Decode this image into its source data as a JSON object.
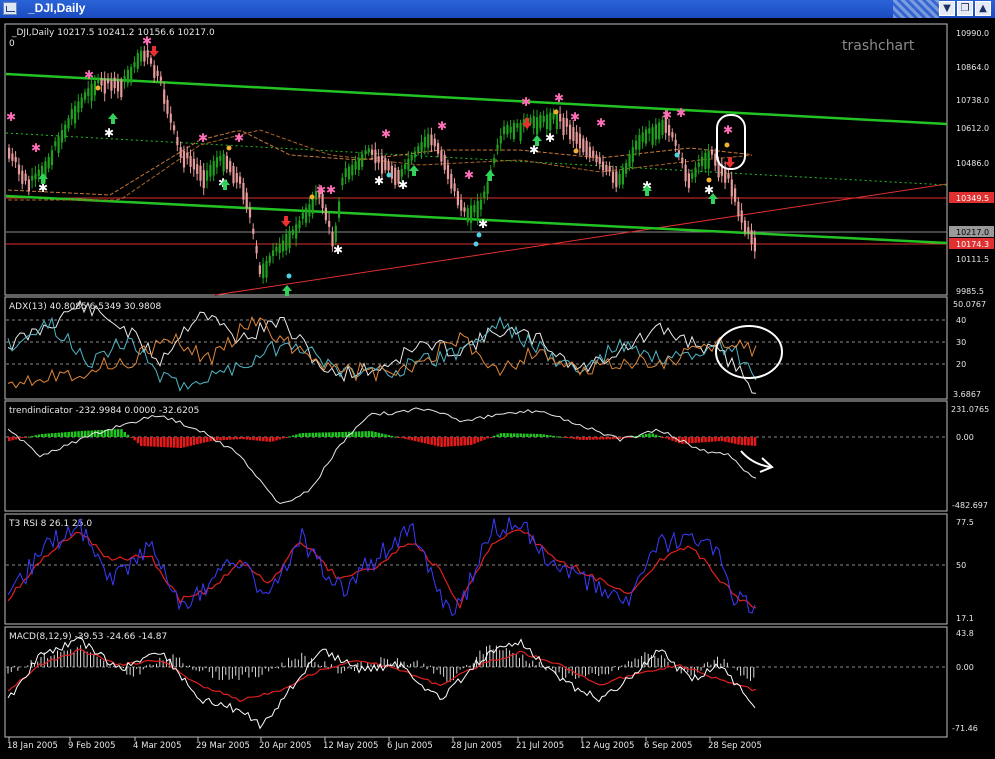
{
  "window": {
    "title": "_DJI,Daily",
    "controls": {
      "minimize": "▼",
      "restore": "❐",
      "close": "▲"
    }
  },
  "colors": {
    "background": "#000000",
    "panel_border": "#c0c0c0",
    "channel_line": "#22c322",
    "support_line": "#e03030",
    "candle_up": "#1fa11f",
    "candle_down": "#e69a9a",
    "adx_plus": "#4fb7c8",
    "adx_minus": "#e0873a",
    "trend_pos": "#1ec81e",
    "trend_neg": "#e61a1a",
    "rsi_fast": "#3b3bff",
    "rsi_slow": "#e02020",
    "macd_main": "#ffffff",
    "macd_signal": "#e02020"
  },
  "main_panel": {
    "header": "_DJI,Daily  10217.5  10241.2  10156.6  10217.0",
    "zero_label": "0",
    "watermark": "trashchart",
    "price_labels": [
      "10990.0",
      "10864.0",
      "10738.0",
      "10612.0",
      "10486.0",
      "10111.5",
      "9985.5"
    ],
    "highlight_labels": [
      {
        "text": "10349.5",
        "color": "#e03030"
      },
      {
        "text": "10217.0",
        "color": "#9a9a9a"
      },
      {
        "text": "10174.3",
        "color": "#e03030"
      }
    ]
  },
  "adx_panel": {
    "header": "ADX(13)  40.8085  6.5349  30.9808",
    "labels": [
      "50.0767",
      "40",
      "30",
      "20",
      "3.6867"
    ]
  },
  "trend_panel": {
    "header": "trendindicator  -232.9984  0.0000  -32.6205",
    "labels": [
      "231.0765",
      "0.00",
      "-482.697"
    ]
  },
  "rsi_panel": {
    "header": "T3 RSI  8  26.1  25.0",
    "labels": [
      "77.5",
      "50",
      "17.1"
    ]
  },
  "macd_panel": {
    "header": "MACD(8,12,9)  -39.53  -24.66  -14.87",
    "labels": [
      "43.8",
      "0.00",
      "-71.46"
    ]
  },
  "x_axis": {
    "labels": [
      "18 Jan 2005",
      "9 Feb 2005",
      "4 Mar 2005",
      "29 Mar 2005",
      "20 Apr 2005",
      "12 May 2005",
      "6 Jun 2005",
      "28 Jun 2005",
      "21 Jul 2005",
      "12 Aug 2005",
      "6 Sep 2005",
      "28 Sep 2005"
    ]
  }
}
